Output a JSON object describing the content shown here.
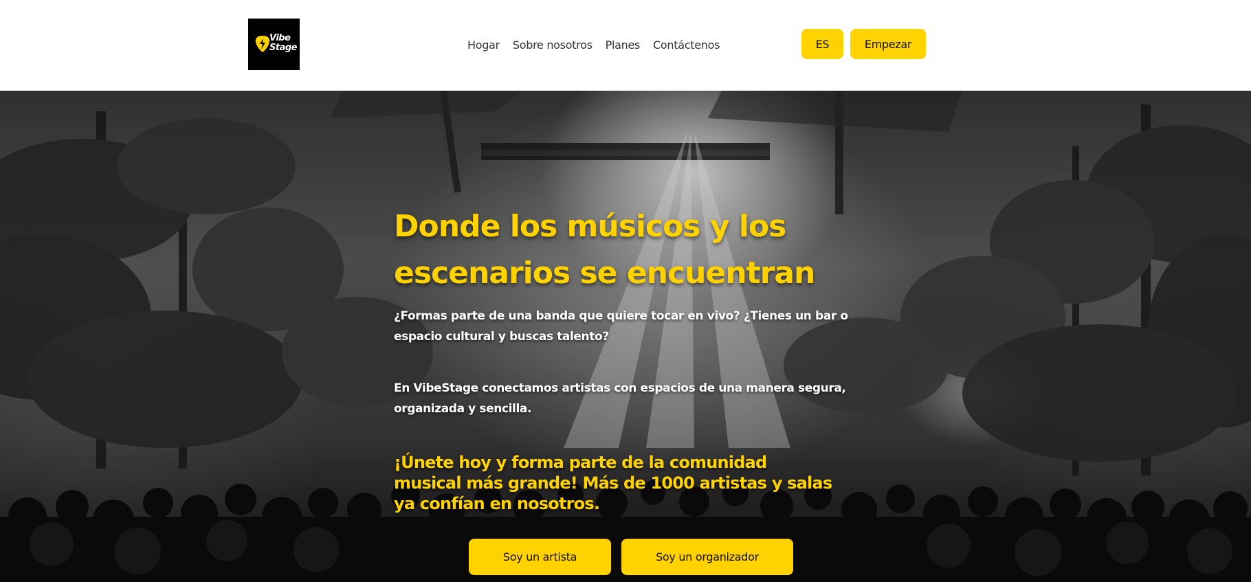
{
  "brand": {
    "logo_line1": "Vibe",
    "logo_line2": "Stage",
    "accent_color": "#FFD200"
  },
  "nav": {
    "items": [
      {
        "label": "Hogar"
      },
      {
        "label": "Sobre nosotros"
      },
      {
        "label": "Planes"
      },
      {
        "label": "Contáctenos"
      }
    ]
  },
  "header": {
    "lang_label": "ES",
    "start_label": "Empezar"
  },
  "hero": {
    "title_line1": "Donde los músicos y los",
    "title_line2": "escenarios se encuentran",
    "paragraph1_line1": "¿Formas parte de una banda que quiere tocar en vivo? ¿Tienes un bar o",
    "paragraph1_line2": "espacio cultural y buscas talento?",
    "paragraph2_line1": "En VibeStage conectamos artistas con espacios de una manera segura,",
    "paragraph2_line2": "organizada y sencilla.",
    "cta_line1": "¡Únete hoy y forma parte de la comunidad",
    "cta_line2": "musical más grande! Más de 1000 artistas y salas",
    "cta_line3": "ya confían en nosotros.",
    "artist_button": "Soy un artista",
    "organizer_button": "Soy un organizador"
  },
  "icons": {
    "logo_icon": "guitar-pick-bolt-icon"
  }
}
